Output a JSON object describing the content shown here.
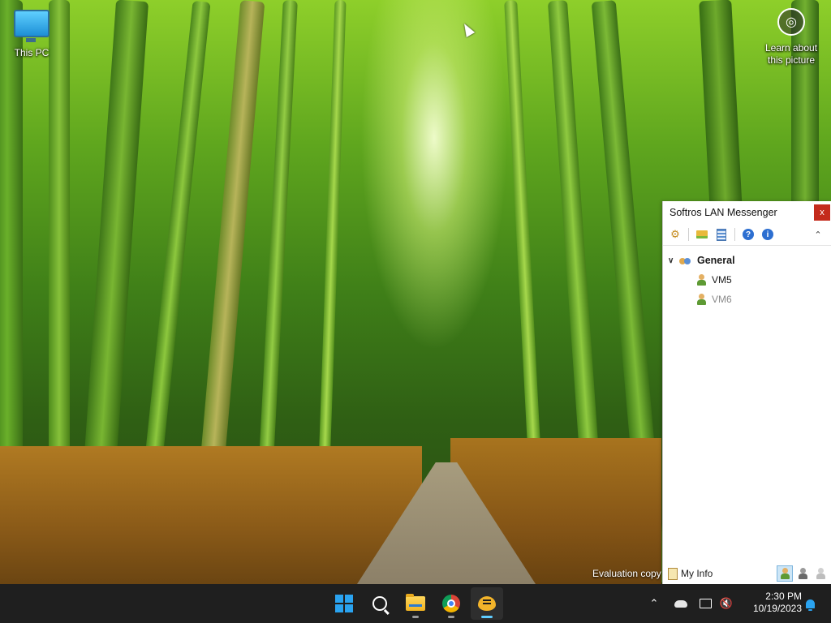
{
  "desktop": {
    "icons": [
      {
        "label": "This PC",
        "icon": "monitor-icon"
      }
    ],
    "spotlight": {
      "label_line1": "Learn about",
      "label_line2": "this picture",
      "icon": "camera-icon"
    },
    "watermark": "Evaluation copy"
  },
  "messenger": {
    "title": "Softros LAN Messenger",
    "close_label": "x",
    "toolbar": [
      {
        "icon": "settings-icon"
      },
      {
        "icon": "open-folder-icon"
      },
      {
        "icon": "message-log-icon"
      },
      {
        "icon": "help-icon"
      },
      {
        "icon": "info-icon"
      },
      {
        "icon": "collapse-icon"
      }
    ],
    "groups": [
      {
        "name": "General",
        "expanded": true,
        "users": [
          {
            "name": "VM5",
            "status": "online"
          },
          {
            "name": "VM6",
            "status": "offline"
          }
        ]
      }
    ],
    "statusbar": {
      "myinfo_label": "My Info",
      "status_options": [
        {
          "icon": "status-online-icon",
          "active": true
        },
        {
          "icon": "status-away-icon",
          "active": false
        },
        {
          "icon": "status-offline-icon",
          "active": false
        }
      ]
    },
    "accent": "#c42b1c"
  },
  "taskbar": {
    "apps": [
      {
        "name": "start",
        "icon": "windows-logo-icon"
      },
      {
        "name": "search",
        "icon": "search-icon"
      },
      {
        "name": "file-explorer",
        "icon": "folder-icon"
      },
      {
        "name": "chrome",
        "icon": "chrome-icon"
      },
      {
        "name": "softros-messenger",
        "icon": "chat-bubble-icon"
      }
    ],
    "tray": {
      "overflow_icon": "chevron-up-icon",
      "icons": [
        "onedrive-icon",
        "display-icon",
        "volume-muted-icon"
      ],
      "time": "2:30 PM",
      "date": "10/19/2023",
      "notification_icon": "bell-icon"
    }
  }
}
